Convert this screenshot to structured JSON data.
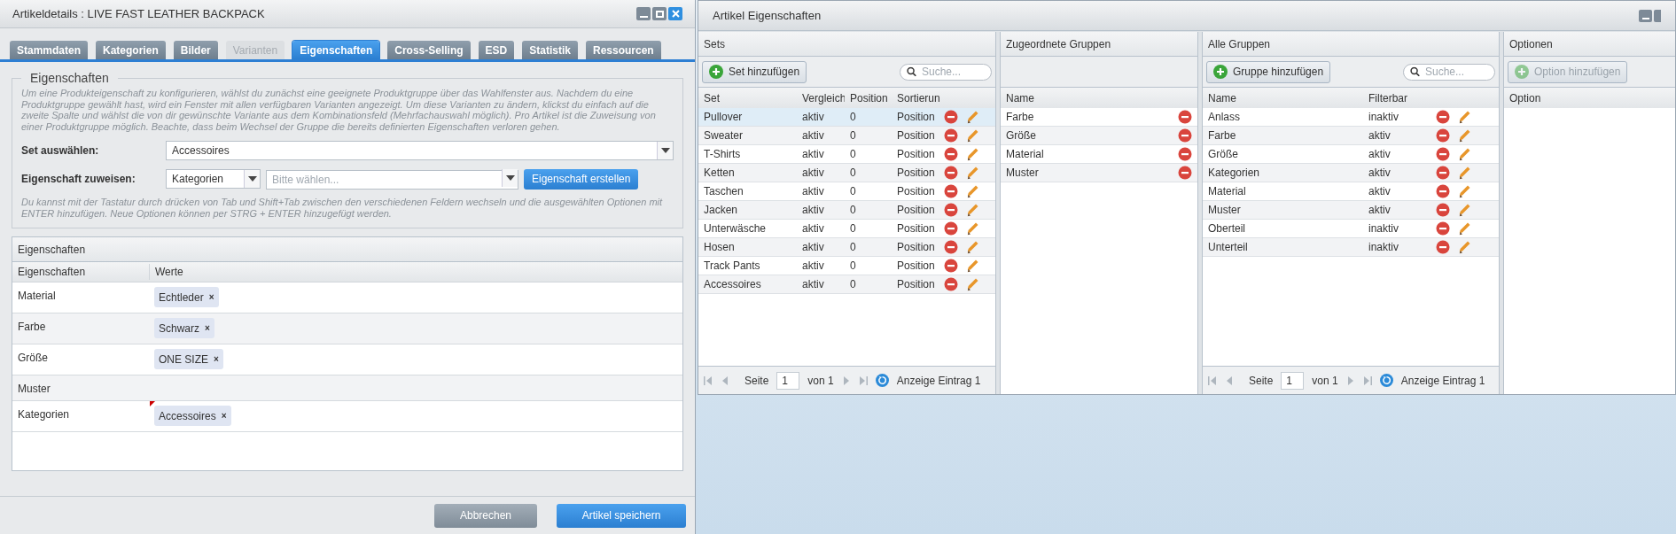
{
  "detail_window": {
    "title": "Artikeldetails : LIVE FAST LEATHER BACKPACK",
    "tabs": [
      {
        "label": "Stammdaten",
        "selected": false,
        "disabled": false
      },
      {
        "label": "Kategorien",
        "selected": false,
        "disabled": false
      },
      {
        "label": "Bilder",
        "selected": false,
        "disabled": false
      },
      {
        "label": "Varianten",
        "selected": false,
        "disabled": true
      },
      {
        "label": "Eigenschaften",
        "selected": true,
        "disabled": false
      },
      {
        "label": "Cross-Selling",
        "selected": false,
        "disabled": false
      },
      {
        "label": "ESD",
        "selected": false,
        "disabled": false
      },
      {
        "label": "Statistik",
        "selected": false,
        "disabled": false
      },
      {
        "label": "Ressourcen",
        "selected": false,
        "disabled": false
      }
    ],
    "fieldset": {
      "legend": "Eigenschaften",
      "description": "Um eine Produkteigenschaft zu konfigurieren, wählst du zunächst eine geeignete Produktgruppe über das Wahlfenster aus. Nachdem du eine Produktgruppe gewählt hast, wird ein Fenster mit allen verfügbaren Varianten angezeigt. Um diese Varianten zu ändern, klickst du einfach auf die zweite Spalte und wählst die von dir gewünschte Variante aus dem Kombinationsfeld (Mehrfachauswahl möglich). Pro Artikel ist die Zuweisung von einer Produktgruppe möglich. Beachte, dass beim Wechsel der Gruppe die bereits definierten Eigenschaften verloren gehen.",
      "set_label": "Set auswählen:",
      "set_value": "Accessoires",
      "assign_label": "Eigenschaft zuweisen:",
      "assign_group": "Kategorien",
      "assign_placeholder": "Bitte wählen...",
      "create_button": "Eigenschaft erstellen",
      "hint": "Du kannst mit der Tastatur durch drücken von Tab und Shift+Tab zwischen den verschiedenen Feldern wechseln und die ausgewählten Optionen mit ENTER hinzufügen. Neue Optionen können per STRG + ENTER hinzugefügt werden."
    },
    "grid": {
      "title": "Eigenschaften",
      "columns": [
        "Eigenschaften",
        "Werte"
      ],
      "rows": [
        {
          "name": "Material",
          "values": [
            {
              "label": "Echtleder",
              "remove": "×"
            }
          ],
          "modified": false
        },
        {
          "name": "Farbe",
          "values": [
            {
              "label": "Schwarz",
              "remove": "×"
            }
          ],
          "modified": false
        },
        {
          "name": "Größe",
          "values": [
            {
              "label": "ONE SIZE",
              "remove": "×"
            }
          ],
          "modified": false
        },
        {
          "name": "Muster",
          "values": [],
          "modified": false
        },
        {
          "name": "Kategorien",
          "values": [
            {
              "label": "Accessoires",
              "remove": "×"
            }
          ],
          "modified": true
        }
      ]
    },
    "buttons": [
      {
        "label": "Abbrechen",
        "kind": "secondary"
      },
      {
        "label": "Artikel speichern",
        "kind": "primary"
      }
    ]
  },
  "properties_window": {
    "title": "Artikel Eigenschaften",
    "sets": {
      "title": "Sets",
      "add_button": "Set hinzufügen",
      "search_placeholder": "Suche...",
      "columns": [
        "Set",
        "Vergleich",
        "Position",
        "Sortierun"
      ],
      "rows": [
        {
          "cells": [
            "Pullover",
            "aktiv",
            "0",
            "Position"
          ],
          "selected": true
        },
        {
          "cells": [
            "Sweater",
            "aktiv",
            "0",
            "Position"
          ],
          "selected": false
        },
        {
          "cells": [
            "T-Shirts",
            "aktiv",
            "0",
            "Position"
          ],
          "selected": false
        },
        {
          "cells": [
            "Ketten",
            "aktiv",
            "0",
            "Position"
          ],
          "selected": false
        },
        {
          "cells": [
            "Taschen",
            "aktiv",
            "0",
            "Position"
          ],
          "selected": false
        },
        {
          "cells": [
            "Jacken",
            "aktiv",
            "0",
            "Position"
          ],
          "selected": false
        },
        {
          "cells": [
            "Unterwäsche",
            "aktiv",
            "0",
            "Position"
          ],
          "selected": false
        },
        {
          "cells": [
            "Hosen",
            "aktiv",
            "0",
            "Position"
          ],
          "selected": false
        },
        {
          "cells": [
            "Track Pants",
            "aktiv",
            "0",
            "Position"
          ],
          "selected": false
        },
        {
          "cells": [
            "Accessoires",
            "aktiv",
            "0",
            "Position"
          ],
          "selected": false
        }
      ],
      "pager": {
        "page_label": "Seite",
        "page": "1",
        "of": "von 1",
        "info": "Anzeige Eintrag 1"
      }
    },
    "assigned": {
      "title": "Zugeordnete Gruppen",
      "columns": [
        "Name"
      ],
      "rows": [
        "Farbe",
        "Größe",
        "Material",
        "Muster"
      ]
    },
    "groups": {
      "title": "Alle Gruppen",
      "add_button": "Gruppe hinzufügen",
      "search_placeholder": "Suche...",
      "columns": [
        "Name",
        "Filterbar"
      ],
      "rows": [
        [
          "Anlass",
          "inaktiv"
        ],
        [
          "Farbe",
          "aktiv"
        ],
        [
          "Größe",
          "aktiv"
        ],
        [
          "Kategorien",
          "aktiv"
        ],
        [
          "Material",
          "aktiv"
        ],
        [
          "Muster",
          "aktiv"
        ],
        [
          "Oberteil",
          "inaktiv"
        ],
        [
          "Unterteil",
          "inaktiv"
        ]
      ],
      "pager": {
        "page_label": "Seite",
        "page": "1",
        "of": "von 1",
        "info": "Anzeige Eintrag 1"
      }
    },
    "options": {
      "title": "Optionen",
      "add_button": "Option hinzufügen",
      "add_disabled": true,
      "columns": [
        "Option"
      ]
    }
  }
}
